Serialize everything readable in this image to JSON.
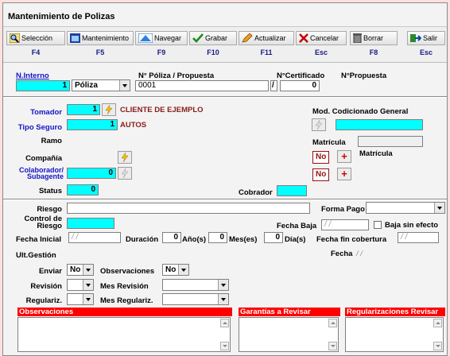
{
  "window": {
    "title": "Mantenimiento de Polizas"
  },
  "toolbar": {
    "buttons": [
      {
        "label": "Selección",
        "key": "F4",
        "icon": "search-icon"
      },
      {
        "label": "Mantenimiento",
        "key": "F5",
        "icon": "window-icon"
      },
      {
        "label": "Navegar",
        "key": "F9",
        "icon": "navigate-icon"
      },
      {
        "label": "Grabar",
        "key": "F10",
        "icon": "check-icon"
      },
      {
        "label": "Actualizar",
        "key": "F11",
        "icon": "pencil-icon"
      },
      {
        "label": "Cancelar",
        "key": "Esc",
        "icon": "x-icon"
      },
      {
        "label": "Borrar",
        "key": "F8",
        "icon": "trash-icon"
      },
      {
        "label": "Salir",
        "key": "Esc",
        "icon": "exit-icon"
      }
    ]
  },
  "header": {
    "n_interno_label": "N.Interno",
    "n_interno_value": "1",
    "tipo_select": "Póliza",
    "poliza_label": "N° Póliza / Propuesta",
    "poliza_value": "0001",
    "certificado_label": "N°Certificado",
    "propuesta_label": "N°Propuesta",
    "certificado_value": "/",
    "propuesta_value": "0"
  },
  "form": {
    "tomador_label": "Tomador",
    "tomador_value": "1",
    "tomador_name": "CLIENTE DE EJEMPLO",
    "tipo_seguro_label": "Tipo Seguro",
    "tipo_seguro_value": "1",
    "tipo_seguro_name": "AUTOS",
    "ramo_label": "Ramo",
    "compania_label": "Compañía",
    "colaborador_label": "Colaborador/ Subagente",
    "colaborador_value": "0",
    "status_label": "Status",
    "status_value": "0",
    "mod_label": "Mod. Codicionado General",
    "matricula_label": "Matrícula",
    "matricula2_label": "Matrícula",
    "no1": "No",
    "no2": "No",
    "cobrador_label": "Cobrador",
    "riesgo_label": "Riesgo",
    "forma_pago_label": "Forma Pago",
    "control_riesgo_label": "Control de Riesgo",
    "fecha_baja_label": "Fecha Baja",
    "fecha_baja_value": "/ /",
    "baja_sin_efecto_label": "Baja sin efecto",
    "fecha_inicial_label": "Fecha Inicial",
    "fecha_inicial_value": "/ /",
    "duracion_label": "Duración",
    "anos_value": "0",
    "anos_label": "Año(s)",
    "meses_value": "0",
    "meses_label": "Mes(es)",
    "dias_value": "0",
    "dias_label": "Día(s)",
    "fecha_fin_label": "Fecha fin cobertura",
    "fecha_fin_value": "/ /",
    "ult_gestion_label": "Ult.Gestión",
    "fecha_label": "Fecha",
    "fecha_value": "/ /",
    "enviar_label": "Enviar",
    "enviar_value": "No",
    "observaciones_label": "Observaciones",
    "observaciones_value": "No",
    "revision_label": "Revisión",
    "mes_revision_label": "Mes Revisión",
    "regulariz_label": "Regulariz.",
    "mes_regulariz_label": "Mes Regulariz."
  },
  "panels": {
    "observaciones": "Observaciones",
    "garantias": "Garantías a Revisar",
    "regularizaciones": "Regularizaciones Revisar"
  },
  "colors": {
    "highlight_field": "#00ffff",
    "panel_header": "#ff0000",
    "label_blue": "#1414c8",
    "label_red": "#8b1a1a"
  }
}
